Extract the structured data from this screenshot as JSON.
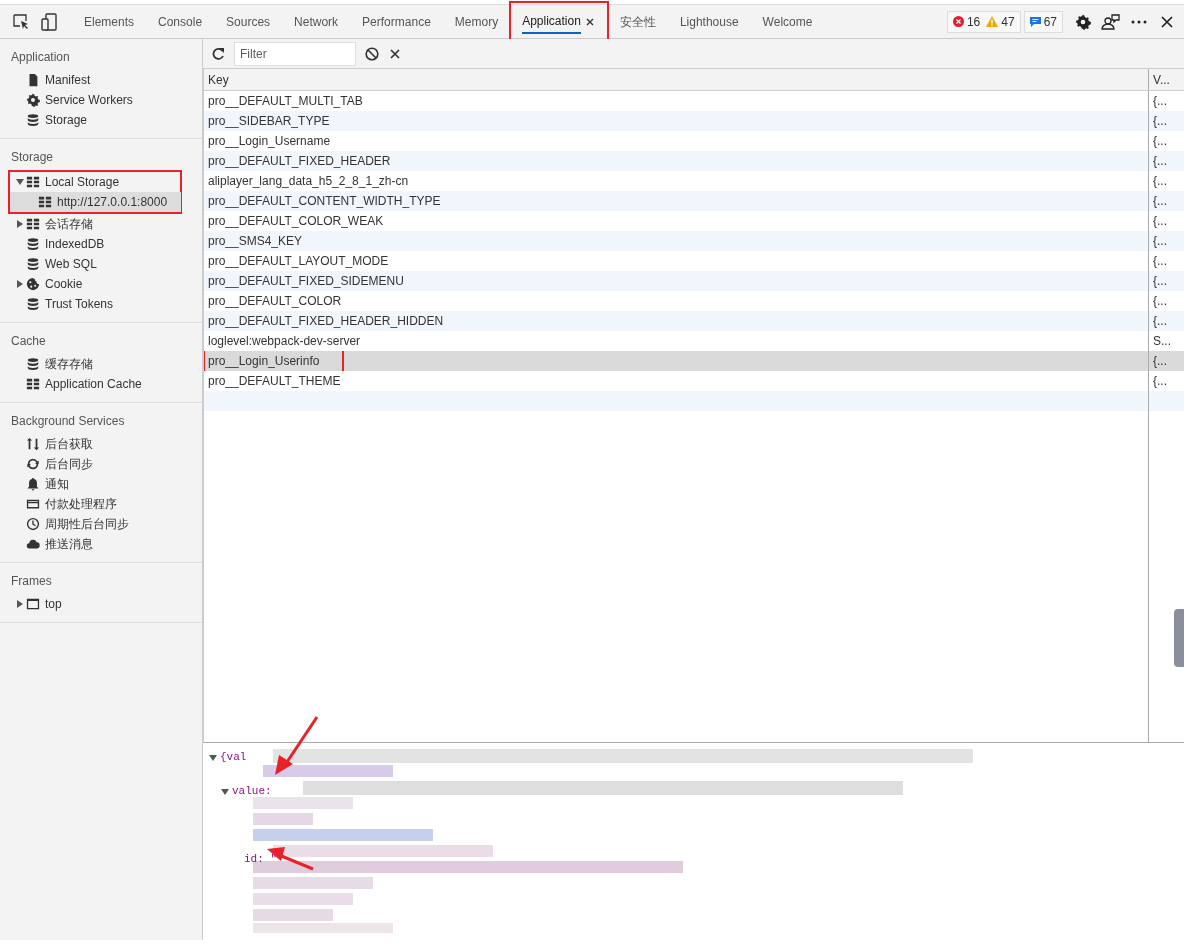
{
  "tabs": [
    {
      "label": "Elements",
      "selected": false,
      "closable": false,
      "highlighted": false
    },
    {
      "label": "Console",
      "selected": false,
      "closable": false,
      "highlighted": false
    },
    {
      "label": "Sources",
      "selected": false,
      "closable": false,
      "highlighted": false
    },
    {
      "label": "Network",
      "selected": false,
      "closable": false,
      "highlighted": false
    },
    {
      "label": "Performance",
      "selected": false,
      "closable": false,
      "highlighted": false
    },
    {
      "label": "Memory",
      "selected": false,
      "closable": false,
      "highlighted": false
    },
    {
      "label": "Application",
      "selected": true,
      "closable": true,
      "highlighted": true
    },
    {
      "label": "安全性",
      "selected": false,
      "closable": false,
      "highlighted": false
    },
    {
      "label": "Lighthouse",
      "selected": false,
      "closable": false,
      "highlighted": false
    },
    {
      "label": "Welcome",
      "selected": false,
      "closable": false,
      "highlighted": false
    }
  ],
  "counters": {
    "errors": "16",
    "warnings": "47",
    "messages": "67"
  },
  "sidebar": [
    {
      "title": "Application",
      "items": [
        {
          "label": "Manifest",
          "kind": "file",
          "selected": false,
          "highlighted": false
        },
        {
          "label": "Service Workers",
          "kind": "gear",
          "selected": false,
          "highlighted": false
        },
        {
          "label": "Storage",
          "kind": "database",
          "selected": false,
          "highlighted": false
        }
      ]
    },
    {
      "title": "Storage",
      "items": [
        {
          "label": "Local Storage",
          "kind": "grid",
          "expanded": true,
          "selected": false,
          "highlighted": true,
          "children": [
            {
              "label": "http://127.0.0.1:8000",
              "kind": "grid",
              "selected": true
            }
          ]
        },
        {
          "label": "会话存储",
          "kind": "grid",
          "expanded": false,
          "selected": false,
          "highlighted": false
        },
        {
          "label": "IndexedDB",
          "kind": "database",
          "selected": false,
          "highlighted": false
        },
        {
          "label": "Web SQL",
          "kind": "database",
          "selected": false,
          "highlighted": false
        },
        {
          "label": "Cookie",
          "kind": "cookie",
          "expanded": false,
          "selected": false,
          "highlighted": false
        },
        {
          "label": "Trust Tokens",
          "kind": "database",
          "selected": false,
          "highlighted": false
        }
      ]
    },
    {
      "title": "Cache",
      "items": [
        {
          "label": "缓存存储",
          "kind": "database",
          "selected": false,
          "highlighted": false
        },
        {
          "label": "Application Cache",
          "kind": "grid",
          "selected": false,
          "highlighted": false
        }
      ]
    },
    {
      "title": "Background Services",
      "items": [
        {
          "label": "后台获取",
          "kind": "updown",
          "selected": false,
          "highlighted": false
        },
        {
          "label": "后台同步",
          "kind": "sync",
          "selected": false,
          "highlighted": false
        },
        {
          "label": "通知",
          "kind": "bell",
          "selected": false,
          "highlighted": false
        },
        {
          "label": "付款处理程序",
          "kind": "card",
          "selected": false,
          "highlighted": false
        },
        {
          "label": "周期性后台同步",
          "kind": "clock",
          "selected": false,
          "highlighted": false
        },
        {
          "label": "推送消息",
          "kind": "cloud",
          "selected": false,
          "highlighted": false
        }
      ]
    },
    {
      "title": "Frames",
      "items": [
        {
          "label": "top",
          "kind": "frame",
          "expanded": false,
          "selected": false,
          "highlighted": false
        }
      ]
    }
  ],
  "filter": {
    "placeholder": "Filter"
  },
  "table": {
    "columns": [
      "Key",
      "V..."
    ],
    "rows": [
      {
        "key": "pro__DEFAULT_MULTI_TAB",
        "value": "{...",
        "selected": false,
        "highlighted": false
      },
      {
        "key": "pro__SIDEBAR_TYPE",
        "value": "{...",
        "selected": false,
        "highlighted": false
      },
      {
        "key": "pro__Login_Username",
        "value": "{...",
        "selected": false,
        "highlighted": false
      },
      {
        "key": "pro__DEFAULT_FIXED_HEADER",
        "value": "{...",
        "selected": false,
        "highlighted": false
      },
      {
        "key": "aliplayer_lang_data_h5_2_8_1_zh-cn",
        "value": "{...",
        "selected": false,
        "highlighted": false
      },
      {
        "key": "pro__DEFAULT_CONTENT_WIDTH_TYPE",
        "value": "{...",
        "selected": false,
        "highlighted": false
      },
      {
        "key": "pro__DEFAULT_COLOR_WEAK",
        "value": "{...",
        "selected": false,
        "highlighted": false
      },
      {
        "key": "pro__SMS4_KEY",
        "value": "{...",
        "selected": false,
        "highlighted": false
      },
      {
        "key": "pro__DEFAULT_LAYOUT_MODE",
        "value": "{...",
        "selected": false,
        "highlighted": false
      },
      {
        "key": "pro__DEFAULT_FIXED_SIDEMENU",
        "value": "{...",
        "selected": false,
        "highlighted": false
      },
      {
        "key": "pro__DEFAULT_COLOR",
        "value": "{...",
        "selected": false,
        "highlighted": false
      },
      {
        "key": "pro__DEFAULT_FIXED_HEADER_HIDDEN",
        "value": "{...",
        "selected": false,
        "highlighted": false
      },
      {
        "key": "loglevel:webpack-dev-server",
        "value": "S...",
        "selected": false,
        "highlighted": false
      },
      {
        "key": "pro__Login_Userinfo",
        "value": "{...",
        "selected": true,
        "highlighted": true
      },
      {
        "key": "pro__DEFAULT_THEME",
        "value": "{...",
        "selected": false,
        "highlighted": false
      }
    ]
  },
  "preview": [
    {
      "text": "{val",
      "expanded": true,
      "children": [
        {
          "text": "value:",
          "expanded": true,
          "children": [
            {
              "text": "id: \""
            }
          ]
        }
      ]
    }
  ]
}
